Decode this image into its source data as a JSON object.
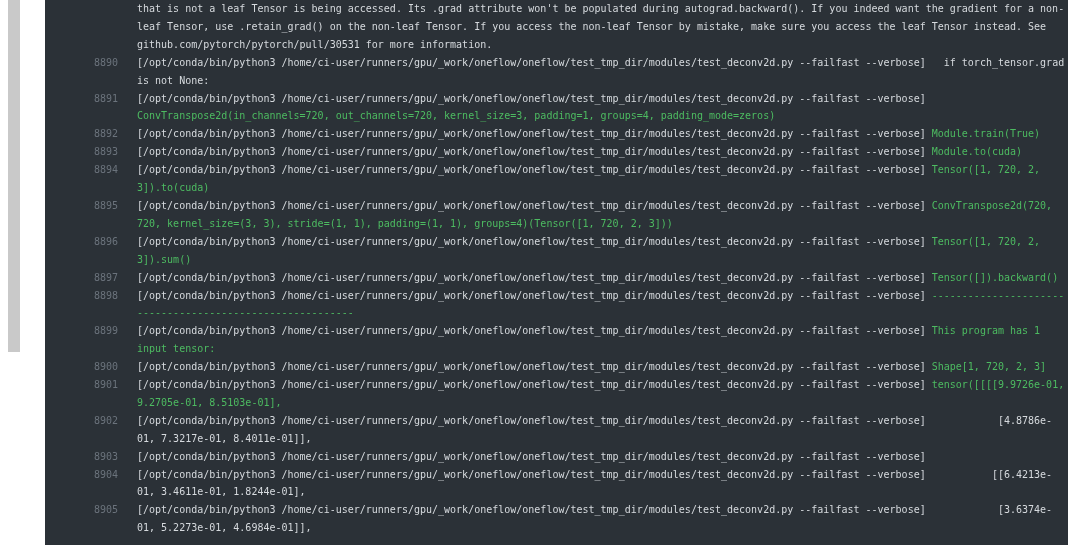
{
  "log": [
    {
      "text": "that is not a leaf Tensor is being accessed. Its .grad attribute won't be populated during autograd.backward(). If you indeed want the gradient for a non-leaf Tensor, use .retain_grad() on the non-leaf Tensor. If you access the non-leaf Tensor by mistake, make sure you access the leaf Tensor instead. See github.com/pytorch/pytorch/pull/30531 for more information.",
      "kind": "continuation"
    },
    {
      "number": "8890",
      "prefix": "[/opt/conda/bin/python3 /home/ci-user/runners/gpu/_work/oneflow/oneflow/test_tmp_dir/modules/test_deconv2d.py --failfast --verbose]",
      "message": "  if torch_tensor.grad is not None:",
      "kind": "plain"
    },
    {
      "number": "8891",
      "prefix": "[/opt/conda/bin/python3 /home/ci-user/runners/gpu/_work/oneflow/oneflow/test_tmp_dir/modules/test_deconv2d.py --failfast --verbose]",
      "message": "ConvTranspose2d(in_channels=720, out_channels=720, kernel_size=3, padding=1, groups=4, padding_mode=zeros)",
      "kind": "output"
    },
    {
      "number": "8892",
      "prefix": "[/opt/conda/bin/python3 /home/ci-user/runners/gpu/_work/oneflow/oneflow/test_tmp_dir/modules/test_deconv2d.py --failfast --verbose]",
      "message": "Module.train(True)",
      "kind": "output"
    },
    {
      "number": "8893",
      "prefix": "[/opt/conda/bin/python3 /home/ci-user/runners/gpu/_work/oneflow/oneflow/test_tmp_dir/modules/test_deconv2d.py --failfast --verbose]",
      "message": "Module.to(cuda)",
      "kind": "output"
    },
    {
      "number": "8894",
      "prefix": "[/opt/conda/bin/python3 /home/ci-user/runners/gpu/_work/oneflow/oneflow/test_tmp_dir/modules/test_deconv2d.py --failfast --verbose]",
      "message": "Tensor([1, 720, 2, 3]).to(cuda)",
      "kind": "output"
    },
    {
      "number": "8895",
      "prefix": "[/opt/conda/bin/python3 /home/ci-user/runners/gpu/_work/oneflow/oneflow/test_tmp_dir/modules/test_deconv2d.py --failfast --verbose]",
      "message": "ConvTranspose2d(720, 720, kernel_size=(3, 3), stride=(1, 1), padding=(1, 1), groups=4)(Tensor([1, 720, 2, 3]))",
      "kind": "output"
    },
    {
      "number": "8896",
      "prefix": "[/opt/conda/bin/python3 /home/ci-user/runners/gpu/_work/oneflow/oneflow/test_tmp_dir/modules/test_deconv2d.py --failfast --verbose]",
      "message": "Tensor([1, 720, 2, 3]).sum()",
      "kind": "output"
    },
    {
      "number": "8897",
      "prefix": "[/opt/conda/bin/python3 /home/ci-user/runners/gpu/_work/oneflow/oneflow/test_tmp_dir/modules/test_deconv2d.py --failfast --verbose]",
      "message": "Tensor([]).backward()",
      "kind": "output"
    },
    {
      "number": "8898",
      "prefix": "[/opt/conda/bin/python3 /home/ci-user/runners/gpu/_work/oneflow/oneflow/test_tmp_dir/modules/test_deconv2d.py --failfast --verbose]",
      "message": "----------------------------------------------------------",
      "kind": "output"
    },
    {
      "number": "8899",
      "prefix": "[/opt/conda/bin/python3 /home/ci-user/runners/gpu/_work/oneflow/oneflow/test_tmp_dir/modules/test_deconv2d.py --failfast --verbose]",
      "message": "This program has 1 input tensor:",
      "kind": "output"
    },
    {
      "number": "8900",
      "prefix": "[/opt/conda/bin/python3 /home/ci-user/runners/gpu/_work/oneflow/oneflow/test_tmp_dir/modules/test_deconv2d.py --failfast --verbose]",
      "message": "Shape[1, 720, 2, 3]",
      "kind": "output"
    },
    {
      "number": "8901",
      "prefix": "[/opt/conda/bin/python3 /home/ci-user/runners/gpu/_work/oneflow/oneflow/test_tmp_dir/modules/test_deconv2d.py --failfast --verbose]",
      "message": "tensor([[[[9.9726e-01, 9.2705e-01, 8.5103e-01],",
      "kind": "output"
    },
    {
      "number": "8902",
      "prefix": "[/opt/conda/bin/python3 /home/ci-user/runners/gpu/_work/oneflow/oneflow/test_tmp_dir/modules/test_deconv2d.py --failfast --verbose]",
      "message": "           [4.8786e-01, 7.3217e-01, 8.4011e-01]],",
      "kind": "plain"
    },
    {
      "number": "8903",
      "prefix": "[/opt/conda/bin/python3 /home/ci-user/runners/gpu/_work/oneflow/oneflow/test_tmp_dir/modules/test_deconv2d.py --failfast --verbose]",
      "kind": "plain"
    },
    {
      "number": "8904",
      "prefix": "[/opt/conda/bin/python3 /home/ci-user/runners/gpu/_work/oneflow/oneflow/test_tmp_dir/modules/test_deconv2d.py --failfast --verbose]",
      "message": "          [[6.4213e-01, 3.4611e-01, 1.8244e-01],",
      "kind": "plain"
    },
    {
      "number": "8905",
      "prefix": "[/opt/conda/bin/python3 /home/ci-user/runners/gpu/_work/oneflow/oneflow/test_tmp_dir/modules/test_deconv2d.py --failfast --verbose]",
      "message": "           [3.6374e-01, 5.2273e-01, 4.6984e-01]],",
      "kind": "plain"
    }
  ]
}
